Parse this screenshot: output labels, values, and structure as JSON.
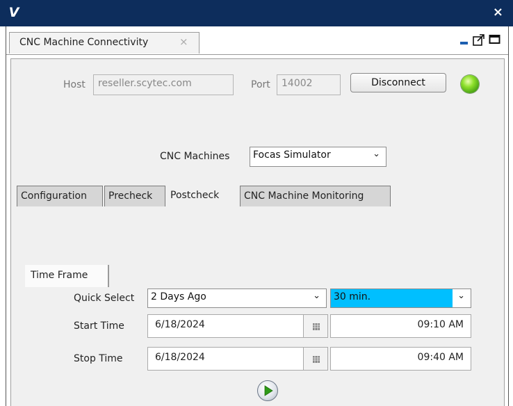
{
  "window": {
    "logo_letter": "V",
    "close_glyph": "×"
  },
  "doc_tab": {
    "title": "CNC Machine Connectivity",
    "close_glyph": "⨯"
  },
  "connection": {
    "host_label": "Host",
    "host_value": "reseller.scytec.com",
    "port_label": "Port",
    "port_value": "14002",
    "disconnect_label": "Disconnect",
    "status_color": "#3f9a10"
  },
  "machines": {
    "label": "CNC Machines",
    "selected": "Focas Simulator"
  },
  "tabs": [
    {
      "label": "Configuration",
      "active": false
    },
    {
      "label": "Precheck",
      "active": false
    },
    {
      "label": "Postcheck",
      "active": true
    },
    {
      "label": "CNC Machine Monitoring",
      "active": false
    }
  ],
  "time_frame": {
    "tab_label": "Time Frame",
    "quick_select_label": "Quick Select",
    "quick_select_value": "2 Days Ago",
    "duration_value": "30 min.",
    "duration_highlight": "#00bfff",
    "start_label": "Start Time",
    "start_date": "6/18/2024",
    "start_time": "09:10 AM",
    "stop_label": "Stop Time",
    "stop_date": "6/18/2024",
    "stop_time": "09:40 AM"
  }
}
